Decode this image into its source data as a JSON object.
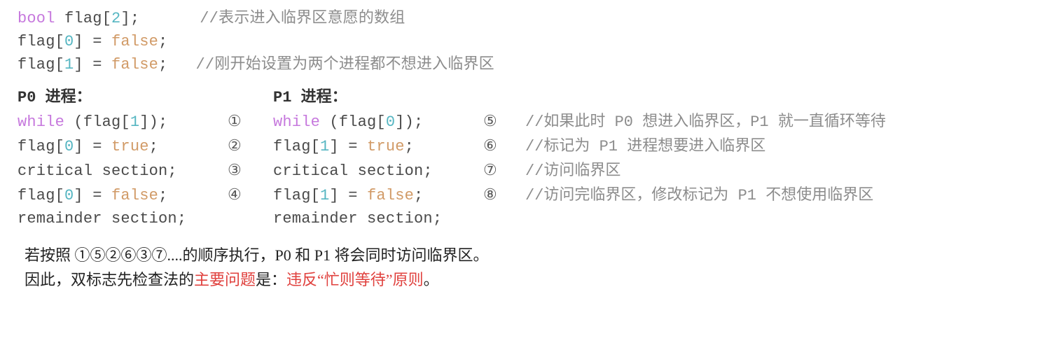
{
  "decl": {
    "l1_kw": "bool",
    "l1_name": " flag[",
    "l1_num": "2",
    "l1_end": "];",
    "l1_com": "//表示进入临界区意愿的数组",
    "l2_a": "flag[",
    "l2_num": "0",
    "l2_b": "] = ",
    "l2_v": "false",
    "l2_end": ";",
    "l3_a": "flag[",
    "l3_num": "1",
    "l3_b": "] = ",
    "l3_v": "false",
    "l3_end": ";",
    "l3_com": "//刚开始设置为两个进程都不想进入临界区"
  },
  "p0": {
    "header": "P0 进程：",
    "l1_kw": "while",
    "l1_rest_a": " (flag[",
    "l1_num": "1",
    "l1_rest_b": "]);",
    "l1_circ": "①",
    "l2_a": "flag[",
    "l2_num": "0",
    "l2_b": "] = ",
    "l2_v": "true",
    "l2_end": ";",
    "l2_circ": "②",
    "l3": "critical section;",
    "l3_circ": "③",
    "l4_a": "flag[",
    "l4_num": "0",
    "l4_b": "] = ",
    "l4_v": "false",
    "l4_end": ";",
    "l4_circ": "④",
    "l5": "remainder section;"
  },
  "p1": {
    "header": "P1 进程：",
    "l1_kw": "while",
    "l1_rest_a": " (flag[",
    "l1_num": "0",
    "l1_rest_b": "]);",
    "l1_circ": "⑤",
    "l1_com": "//如果此时 P0 想进入临界区，P1 就一直循环等待",
    "l2_a": "flag[",
    "l2_num": "1",
    "l2_b": "] = ",
    "l2_v": "true",
    "l2_end": ";",
    "l2_circ": "⑥",
    "l2_com": "//标记为 P1 进程想要进入临界区",
    "l3": "critical section;",
    "l3_circ": "⑦",
    "l3_com": "//访问临界区",
    "l4_a": "flag[",
    "l4_num": "1",
    "l4_b": "] = ",
    "l4_v": "false",
    "l4_end": ";",
    "l4_circ": "⑧",
    "l4_com": "//访问完临界区，修改标记为 P1 不想使用临界区",
    "l5": "remainder section;"
  },
  "notes": {
    "line1": "若按照 ①⑤②⑥③⑦....的顺序执行，P0 和 P1 将会同时访问临界区。",
    "line2a": "因此，双标志先检查法的",
    "line2b": "主要问题",
    "line2c": "是：",
    "line2d": "违反“忙则等待”原则",
    "line2e": "。"
  }
}
